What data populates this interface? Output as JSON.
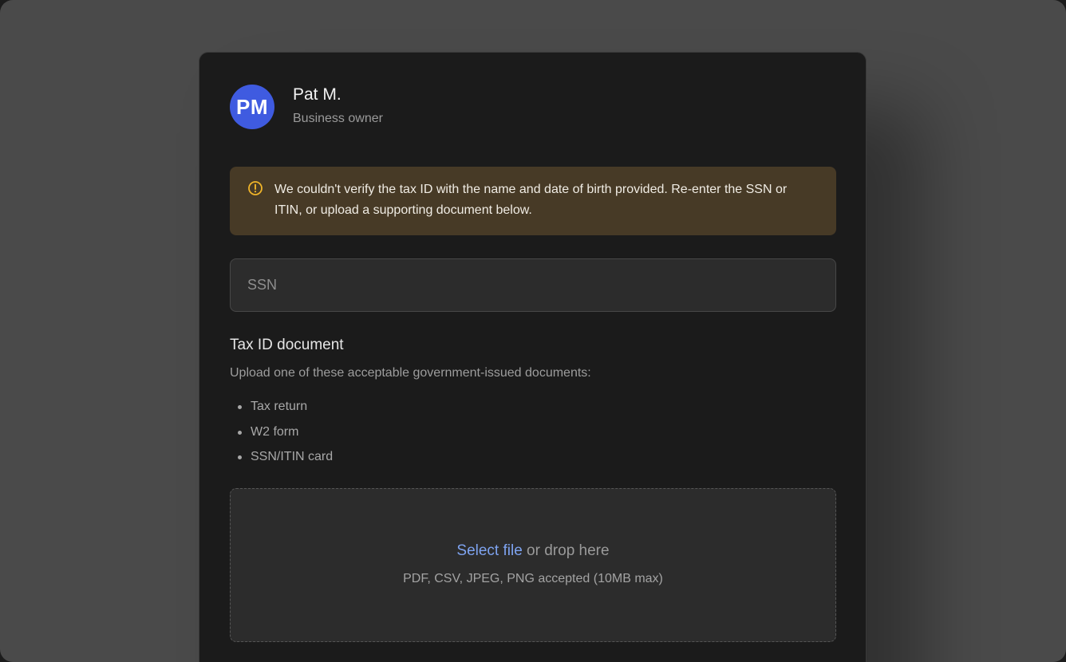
{
  "profile": {
    "initials": "PM",
    "name": "Pat M.",
    "role": "Business owner"
  },
  "alert": {
    "icon": "warning-circle-icon",
    "message": "We couldn't verify the tax ID with the name and date of birth provided. Re-enter the SSN or ITIN, or upload a supporting document below."
  },
  "ssn_field": {
    "placeholder": "SSN",
    "value": ""
  },
  "tax_document": {
    "title": "Tax ID document",
    "description": "Upload one of these acceptable government-issued documents:",
    "items": [
      {
        "label": "Tax return"
      },
      {
        "label": "W2 form"
      },
      {
        "label": "SSN/ITIN card"
      }
    ]
  },
  "upload": {
    "select_link": "Select file",
    "drop_text": " or drop here",
    "hint": "PDF, CSV, JPEG, PNG accepted (10MB max)"
  },
  "colors": {
    "background": "#4a4a4a",
    "card": "#1b1b1b",
    "avatar": "#3f5be0",
    "alert_bg": "#473a26",
    "alert_icon": "#f0b429",
    "link": "#7ea3f0"
  }
}
